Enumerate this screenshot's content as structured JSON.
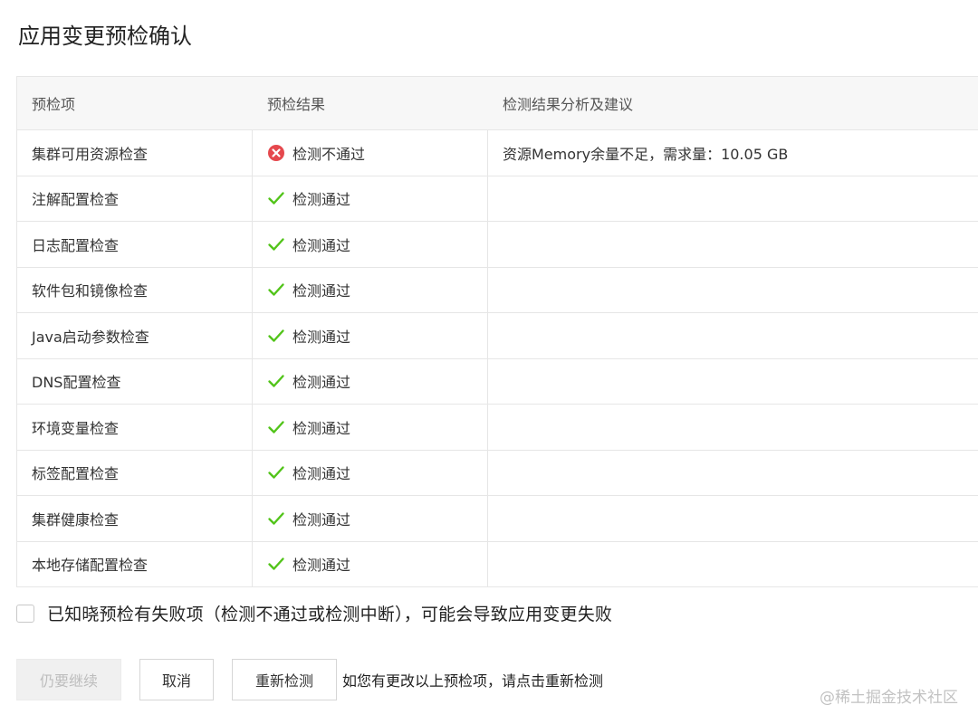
{
  "page": {
    "title": "应用变更预检确认"
  },
  "table": {
    "headers": [
      "预检项",
      "预检结果",
      "检测结果分析及建议"
    ],
    "rows": [
      {
        "item": "集群可用资源检查",
        "status": "fail",
        "result": "检测不通过",
        "advice": "资源Memory余量不足，需求量：10.05 GB"
      },
      {
        "item": "注解配置检查",
        "status": "pass",
        "result": "检测通过",
        "advice": ""
      },
      {
        "item": "日志配置检查",
        "status": "pass",
        "result": "检测通过",
        "advice": ""
      },
      {
        "item": "软件包和镜像检查",
        "status": "pass",
        "result": "检测通过",
        "advice": ""
      },
      {
        "item": "Java启动参数检查",
        "status": "pass",
        "result": "检测通过",
        "advice": ""
      },
      {
        "item": "DNS配置检查",
        "status": "pass",
        "result": "检测通过",
        "advice": ""
      },
      {
        "item": "环境变量检查",
        "status": "pass",
        "result": "检测通过",
        "advice": ""
      },
      {
        "item": "标签配置检查",
        "status": "pass",
        "result": "检测通过",
        "advice": ""
      },
      {
        "item": "集群健康检查",
        "status": "pass",
        "result": "检测通过",
        "advice": ""
      },
      {
        "item": "本地存储配置检查",
        "status": "pass",
        "result": "检测通过",
        "advice": ""
      }
    ]
  },
  "acknowledge": {
    "checked": false,
    "label": "已知晓预检有失败项（检测不通过或检测中断），可能会导致应用变更失败"
  },
  "actions": {
    "continue_label": "仍要继续",
    "cancel_label": "取消",
    "recheck_label": "重新检测",
    "hint": "如您有更改以上预检项，请点击重新检测"
  },
  "watermark": "@稀土掘金技术社区",
  "colors": {
    "pass": "#52c41a",
    "fail": "#e5484d",
    "border": "#e6e6e6",
    "header_bg": "#f7f7f7"
  },
  "icons": {
    "pass": "check-icon",
    "fail": "close-circle-icon"
  }
}
